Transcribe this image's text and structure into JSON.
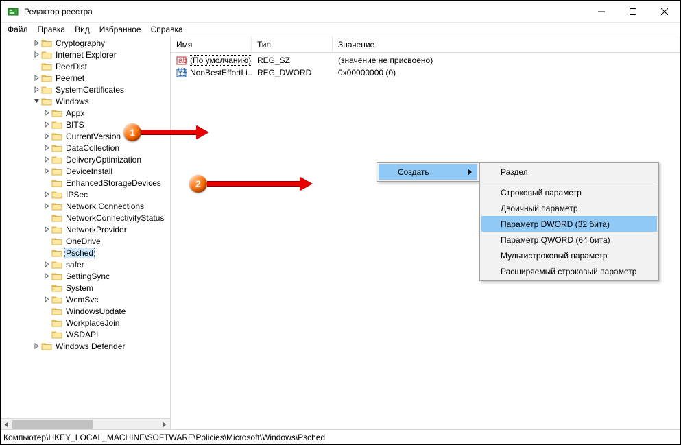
{
  "window": {
    "title": "Редактор реестра"
  },
  "menubar": {
    "file": "Файл",
    "edit": "Правка",
    "view": "Вид",
    "favorites": "Избранное",
    "help": "Справка"
  },
  "tree": [
    {
      "indent": 3,
      "exp": ">",
      "label": "Cryptography"
    },
    {
      "indent": 3,
      "exp": ">",
      "label": "Internet Explorer"
    },
    {
      "indent": 3,
      "exp": "",
      "label": "PeerDist"
    },
    {
      "indent": 3,
      "exp": ">",
      "label": "Peernet"
    },
    {
      "indent": 3,
      "exp": ">",
      "label": "SystemCertificates"
    },
    {
      "indent": 3,
      "exp": "v",
      "label": "Windows"
    },
    {
      "indent": 4,
      "exp": ">",
      "label": "Appx"
    },
    {
      "indent": 4,
      "exp": ">",
      "label": "BITS"
    },
    {
      "indent": 4,
      "exp": ">",
      "label": "CurrentVersion"
    },
    {
      "indent": 4,
      "exp": ">",
      "label": "DataCollection"
    },
    {
      "indent": 4,
      "exp": ">",
      "label": "DeliveryOptimization"
    },
    {
      "indent": 4,
      "exp": ">",
      "label": "DeviceInstall"
    },
    {
      "indent": 4,
      "exp": "",
      "label": "EnhancedStorageDevices"
    },
    {
      "indent": 4,
      "exp": ">",
      "label": "IPSec"
    },
    {
      "indent": 4,
      "exp": ">",
      "label": "Network Connections"
    },
    {
      "indent": 4,
      "exp": "",
      "label": "NetworkConnectivityStatus"
    },
    {
      "indent": 4,
      "exp": ">",
      "label": "NetworkProvider"
    },
    {
      "indent": 4,
      "exp": "",
      "label": "OneDrive"
    },
    {
      "indent": 4,
      "exp": "",
      "label": "Psched",
      "selected": true
    },
    {
      "indent": 4,
      "exp": ">",
      "label": "safer"
    },
    {
      "indent": 4,
      "exp": ">",
      "label": "SettingSync"
    },
    {
      "indent": 4,
      "exp": "",
      "label": "System"
    },
    {
      "indent": 4,
      "exp": ">",
      "label": "WcmSvc"
    },
    {
      "indent": 4,
      "exp": "",
      "label": "WindowsUpdate"
    },
    {
      "indent": 4,
      "exp": "",
      "label": "WorkplaceJoin"
    },
    {
      "indent": 4,
      "exp": "",
      "label": "WSDAPI"
    },
    {
      "indent": 3,
      "exp": ">",
      "label": "Windows Defender"
    }
  ],
  "list": {
    "cols": {
      "name": "Имя",
      "type": "Тип",
      "value": "Значение"
    },
    "rows": [
      {
        "icon": "str",
        "name": "(По умолчанию)",
        "type": "REG_SZ",
        "value": "(значение не присвоено)",
        "focused": true
      },
      {
        "icon": "bin",
        "name": "NonBestEffortLi...",
        "type": "REG_DWORD",
        "value": "0x00000000 (0)"
      }
    ]
  },
  "context": {
    "create": "Создать",
    "sub": {
      "section": "Раздел",
      "string": "Строковый параметр",
      "binary": "Двоичный параметр",
      "dword": "Параметр DWORD (32 бита)",
      "qword": "Параметр QWORD (64 бита)",
      "multi": "Мультистроковый параметр",
      "expand": "Расширяемый строковый параметр"
    }
  },
  "callouts": {
    "one": "1",
    "two": "2"
  },
  "status": "Компьютер\\HKEY_LOCAL_MACHINE\\SOFTWARE\\Policies\\Microsoft\\Windows\\Psched"
}
